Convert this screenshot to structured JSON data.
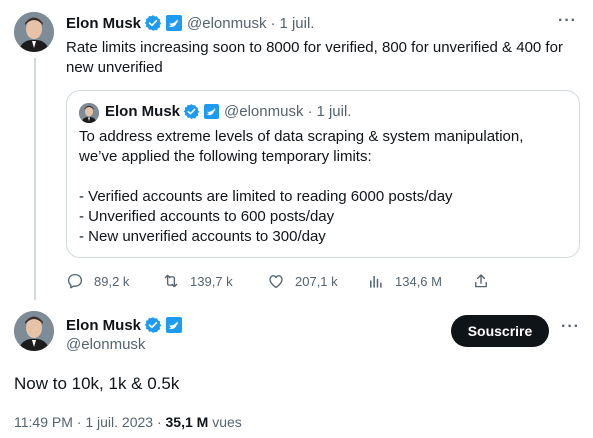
{
  "tweet1": {
    "author_name": "Elon Musk",
    "handle": "@elonmusk",
    "separator": "·",
    "date": "1 juil.",
    "more": "···",
    "text": "Rate limits increasing soon to 8000 for verified, 800 for unverified & 400 for new unverified"
  },
  "quote": {
    "author_name": "Elon Musk",
    "handle": "@elonmusk",
    "separator": "·",
    "date": "1 juil.",
    "line1": "To address extreme levels of data scraping & system manipulation,",
    "line2": "we’ve applied the following temporary limits:",
    "line3": "- Verified accounts are limited to reading 6000 posts/day",
    "line4": "- Unverified accounts to 600 posts/day",
    "line5": "- New unverified accounts to 300/day"
  },
  "actions": {
    "replies": "89,2 k",
    "reposts": "139,7 k",
    "likes": "207,1 k",
    "views": "134,6 M"
  },
  "tweet2": {
    "author_name": "Elon Musk",
    "handle": "@elonmusk",
    "subscribe_label": "Souscrire",
    "more": "···",
    "text": "Now to 10k, 1k & 0.5k",
    "time": "11:49 PM",
    "separator": "·",
    "date": "1 juil. 2023",
    "separator2": "·",
    "views_count": "35,1 M",
    "views_label": "vues"
  },
  "colors": {
    "verified_blue": "#1d9bf0",
    "text_primary": "#0f1419",
    "text_secondary": "#536471",
    "border": "#cfd9de"
  }
}
